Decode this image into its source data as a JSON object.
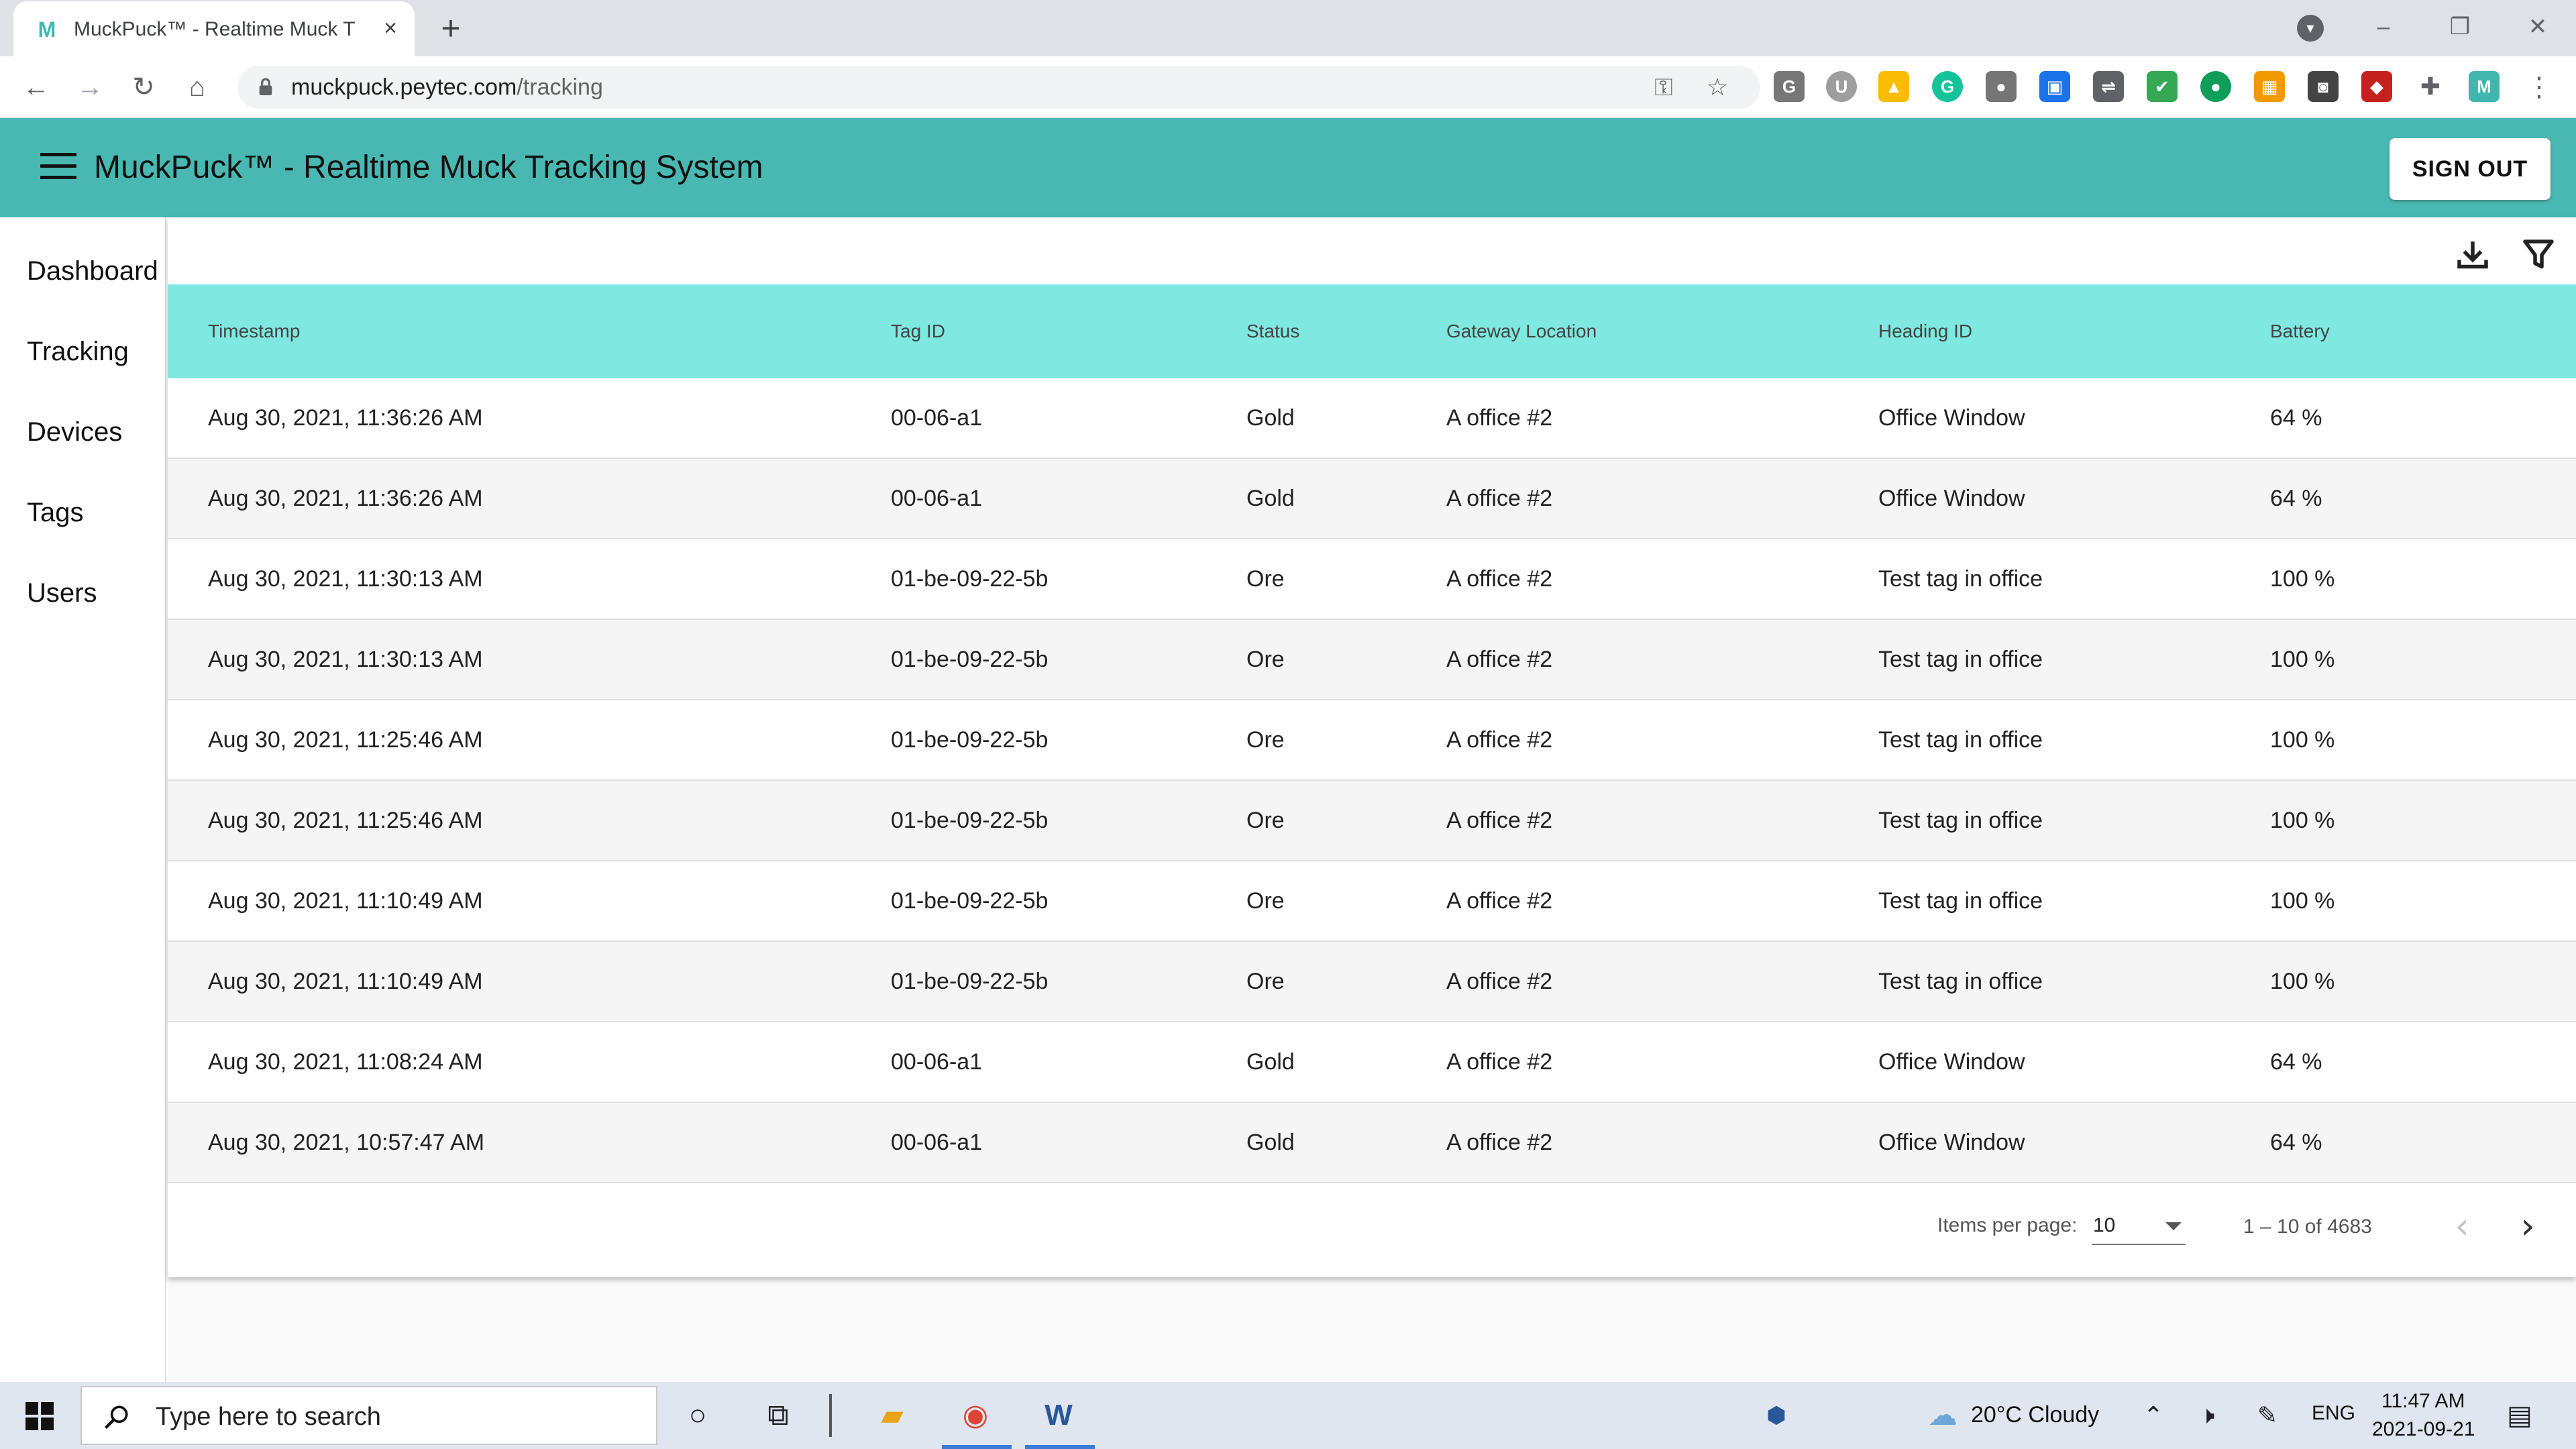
{
  "browser": {
    "tab_title": "MuckPuck™ - Realtime Muck Tra",
    "url_host": "muckpuck.peytec.com",
    "url_path": "/tracking"
  },
  "app": {
    "title": "MuckPuck™ - Realtime Muck Tracking System",
    "sign_out_label": "SIGN OUT"
  },
  "sidebar": {
    "items": [
      {
        "label": "Dashboard"
      },
      {
        "label": "Tracking"
      },
      {
        "label": "Devices"
      },
      {
        "label": "Tags"
      },
      {
        "label": "Users"
      }
    ]
  },
  "table": {
    "columns": [
      "Timestamp",
      "Tag ID",
      "Status",
      "Gateway Location",
      "Heading ID",
      "Battery"
    ],
    "rows": [
      [
        "Aug 30, 2021, 11:36:26 AM",
        "00-06-a1",
        "Gold",
        "A office #2",
        "Office Window",
        "64 %"
      ],
      [
        "Aug 30, 2021, 11:36:26 AM",
        "00-06-a1",
        "Gold",
        "A office #2",
        "Office Window",
        "64 %"
      ],
      [
        "Aug 30, 2021, 11:30:13 AM",
        "01-be-09-22-5b",
        "Ore",
        "A office #2",
        "Test tag in office",
        "100 %"
      ],
      [
        "Aug 30, 2021, 11:30:13 AM",
        "01-be-09-22-5b",
        "Ore",
        "A office #2",
        "Test tag in office",
        "100 %"
      ],
      [
        "Aug 30, 2021, 11:25:46 AM",
        "01-be-09-22-5b",
        "Ore",
        "A office #2",
        "Test tag in office",
        "100 %"
      ],
      [
        "Aug 30, 2021, 11:25:46 AM",
        "01-be-09-22-5b",
        "Ore",
        "A office #2",
        "Test tag in office",
        "100 %"
      ],
      [
        "Aug 30, 2021, 11:10:49 AM",
        "01-be-09-22-5b",
        "Ore",
        "A office #2",
        "Test tag in office",
        "100 %"
      ],
      [
        "Aug 30, 2021, 11:10:49 AM",
        "01-be-09-22-5b",
        "Ore",
        "A office #2",
        "Test tag in office",
        "100 %"
      ],
      [
        "Aug 30, 2021, 11:08:24 AM",
        "00-06-a1",
        "Gold",
        "A office #2",
        "Office Window",
        "64 %"
      ],
      [
        "Aug 30, 2021, 10:57:47 AM",
        "00-06-a1",
        "Gold",
        "A office #2",
        "Office Window",
        "64 %"
      ]
    ]
  },
  "paginator": {
    "items_per_page_label": "Items per page:",
    "items_per_page_value": "10",
    "range_label": "1 – 10 of 4683"
  },
  "taskbar": {
    "search_placeholder": "Type here to search",
    "weather": "20°C  Cloudy",
    "language": "ENG",
    "time": "11:47 AM",
    "date": "2021-09-21"
  },
  "colors": {
    "app_bar": "#4ab8b2",
    "table_header": "#7fe8e0",
    "row_alt": "#f5f5f5"
  }
}
